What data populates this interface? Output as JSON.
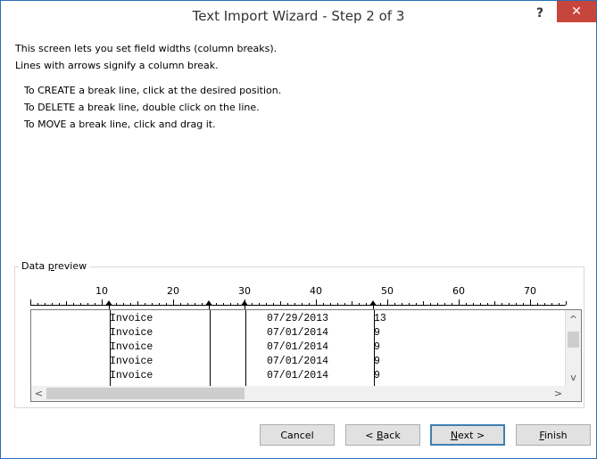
{
  "window": {
    "title": "Text Import Wizard - Step 2 of 3",
    "help_symbol": "?",
    "close_symbol": "✕"
  },
  "instructions": {
    "line1": "This screen lets you set field widths (column breaks).",
    "line2": "Lines with arrows signify a column break.",
    "create": "To CREATE a break line, click at the desired position.",
    "delete": "To DELETE a break line, double click on the line.",
    "move": "To MOVE a break line, click and drag it."
  },
  "preview": {
    "legend_before": "Data ",
    "legend_accel": "p",
    "legend_after": "review",
    "ruler_labels": [
      "10",
      "20",
      "30",
      "40",
      "50",
      "60",
      "70"
    ],
    "rows": [
      {
        "col1": "Invoice",
        "col2": "07/29/2013",
        "col3": "13"
      },
      {
        "col1": "Invoice",
        "col2": "07/01/2014",
        "col3": "9"
      },
      {
        "col1": "Invoice",
        "col2": "07/01/2014",
        "col3": "9"
      },
      {
        "col1": "Invoice",
        "col2": "07/01/2014",
        "col3": "9"
      },
      {
        "col1": "Invoice",
        "col2": "07/01/2014",
        "col3": "9"
      }
    ],
    "column_breaks": [
      11,
      25,
      30,
      48
    ],
    "scroll_up": "^",
    "scroll_down": "v",
    "scroll_left": "<",
    "scroll_right": ">"
  },
  "buttons": {
    "cancel": "Cancel",
    "back_prefix": "< ",
    "back_accel": "B",
    "back_rest": "ack",
    "next_accel": "N",
    "next_rest": "ext >",
    "finish_accel": "F",
    "finish_rest": "inish"
  },
  "colors": {
    "close_button": "#c7463c",
    "border": "#2b6fb3"
  }
}
